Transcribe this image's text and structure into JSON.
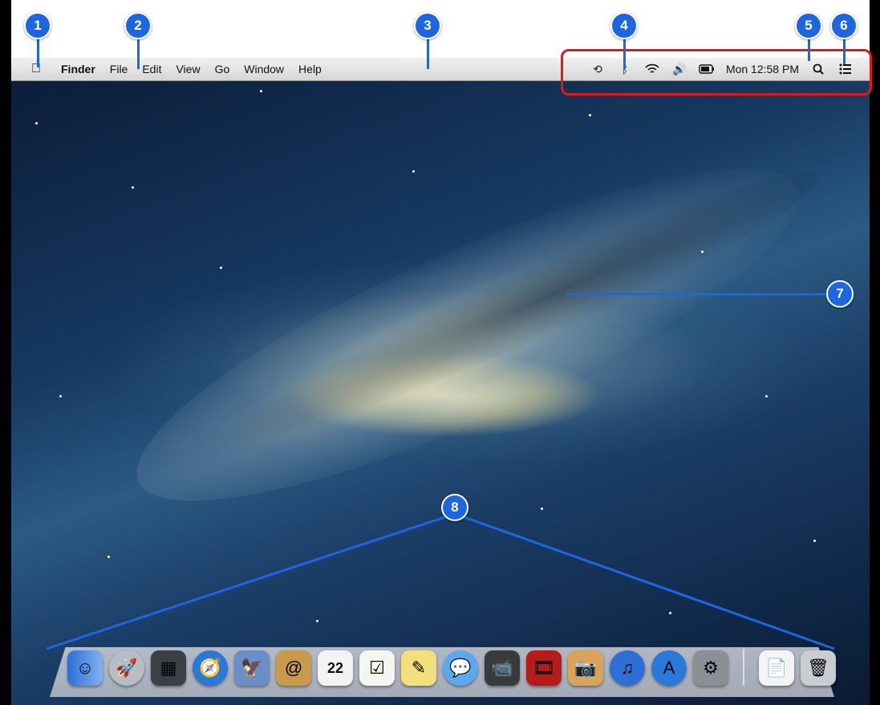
{
  "menubar": {
    "apple_icon": "apple-icon",
    "items": [
      "Finder",
      "File",
      "Edit",
      "View",
      "Go",
      "Window",
      "Help"
    ],
    "status": {
      "icons": [
        "time-machine-icon",
        "bluetooth-icon",
        "wifi-icon",
        "volume-icon",
        "battery-icon"
      ],
      "clock": "Mon 12:58 PM",
      "spotlight_icon": "search-icon",
      "notification_icon": "list-icon"
    }
  },
  "callouts": [
    "1",
    "2",
    "3",
    "4",
    "5",
    "6",
    "7",
    "8"
  ],
  "dock": {
    "icons": [
      "finder",
      "launchpad",
      "mission-control",
      "safari",
      "preview",
      "contacts",
      "calendar",
      "reminders",
      "notes",
      "messages",
      "facetime",
      "photo-booth",
      "iphoto",
      "itunes",
      "app-store",
      "system-preferences",
      "documents",
      "trash"
    ],
    "calendar_day": "22"
  },
  "colors": {
    "callout": "#1e66e0",
    "highlight": "#e01818"
  }
}
